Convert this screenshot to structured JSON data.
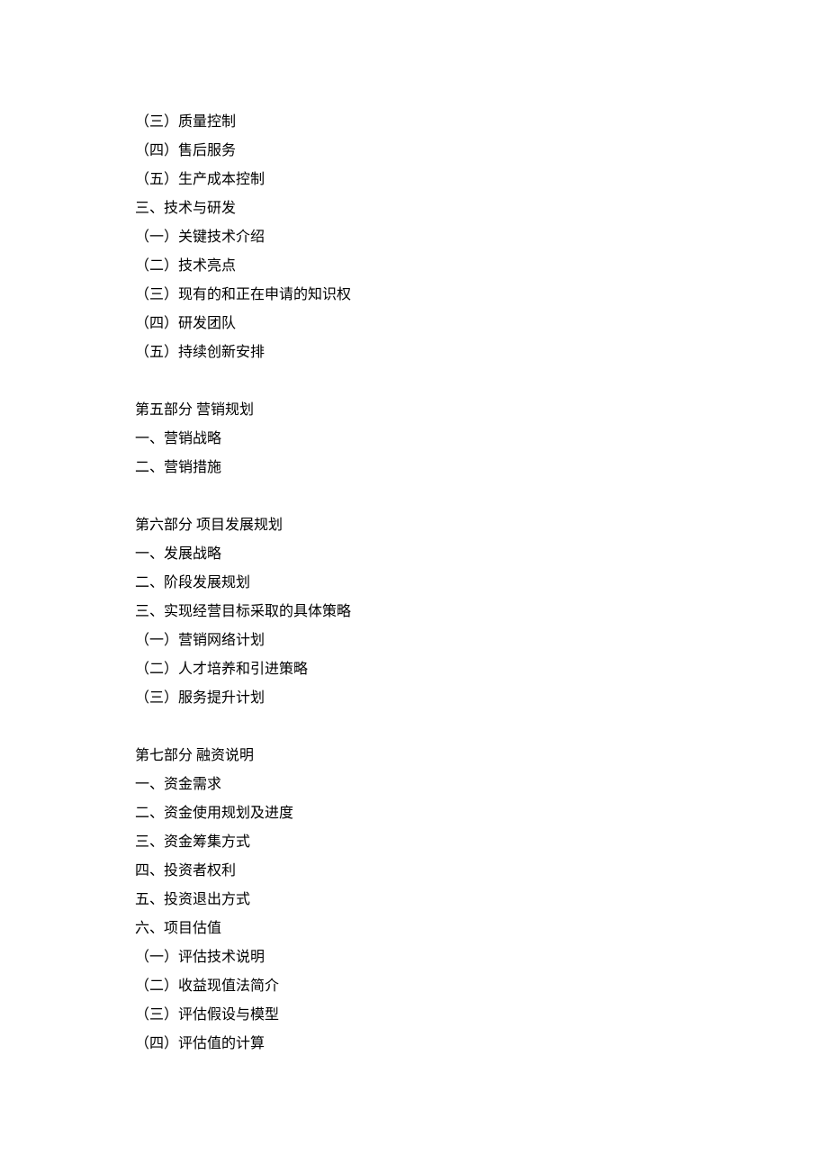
{
  "lines": [
    "（三）质量控制",
    "（四）售后服务",
    "（五）生产成本控制",
    "三、技术与研发",
    "（一）关键技术介绍",
    "（二）技术亮点",
    "（三）现有的和正在申请的知识权",
    "（四）研发团队",
    "（五）持续创新安排",
    "",
    "第五部分  营销规划",
    "一、营销战略",
    "二、营销措施",
    "",
    "第六部分  项目发展规划",
    "一、发展战略",
    "二、阶段发展规划",
    "三、实现经营目标采取的具体策略",
    "（一）营销网络计划",
    "（二）人才培养和引进策略",
    "（三）服务提升计划",
    "",
    "第七部分  融资说明",
    "一、资金需求",
    "二、资金使用规划及进度",
    "三、资金筹集方式",
    "四、投资者权利",
    "五、投资退出方式",
    "六、项目估值",
    "（一）评估技术说明",
    "（二）收益现值法简介",
    "（三）评估假设与模型",
    "（四）评估值的计算"
  ]
}
